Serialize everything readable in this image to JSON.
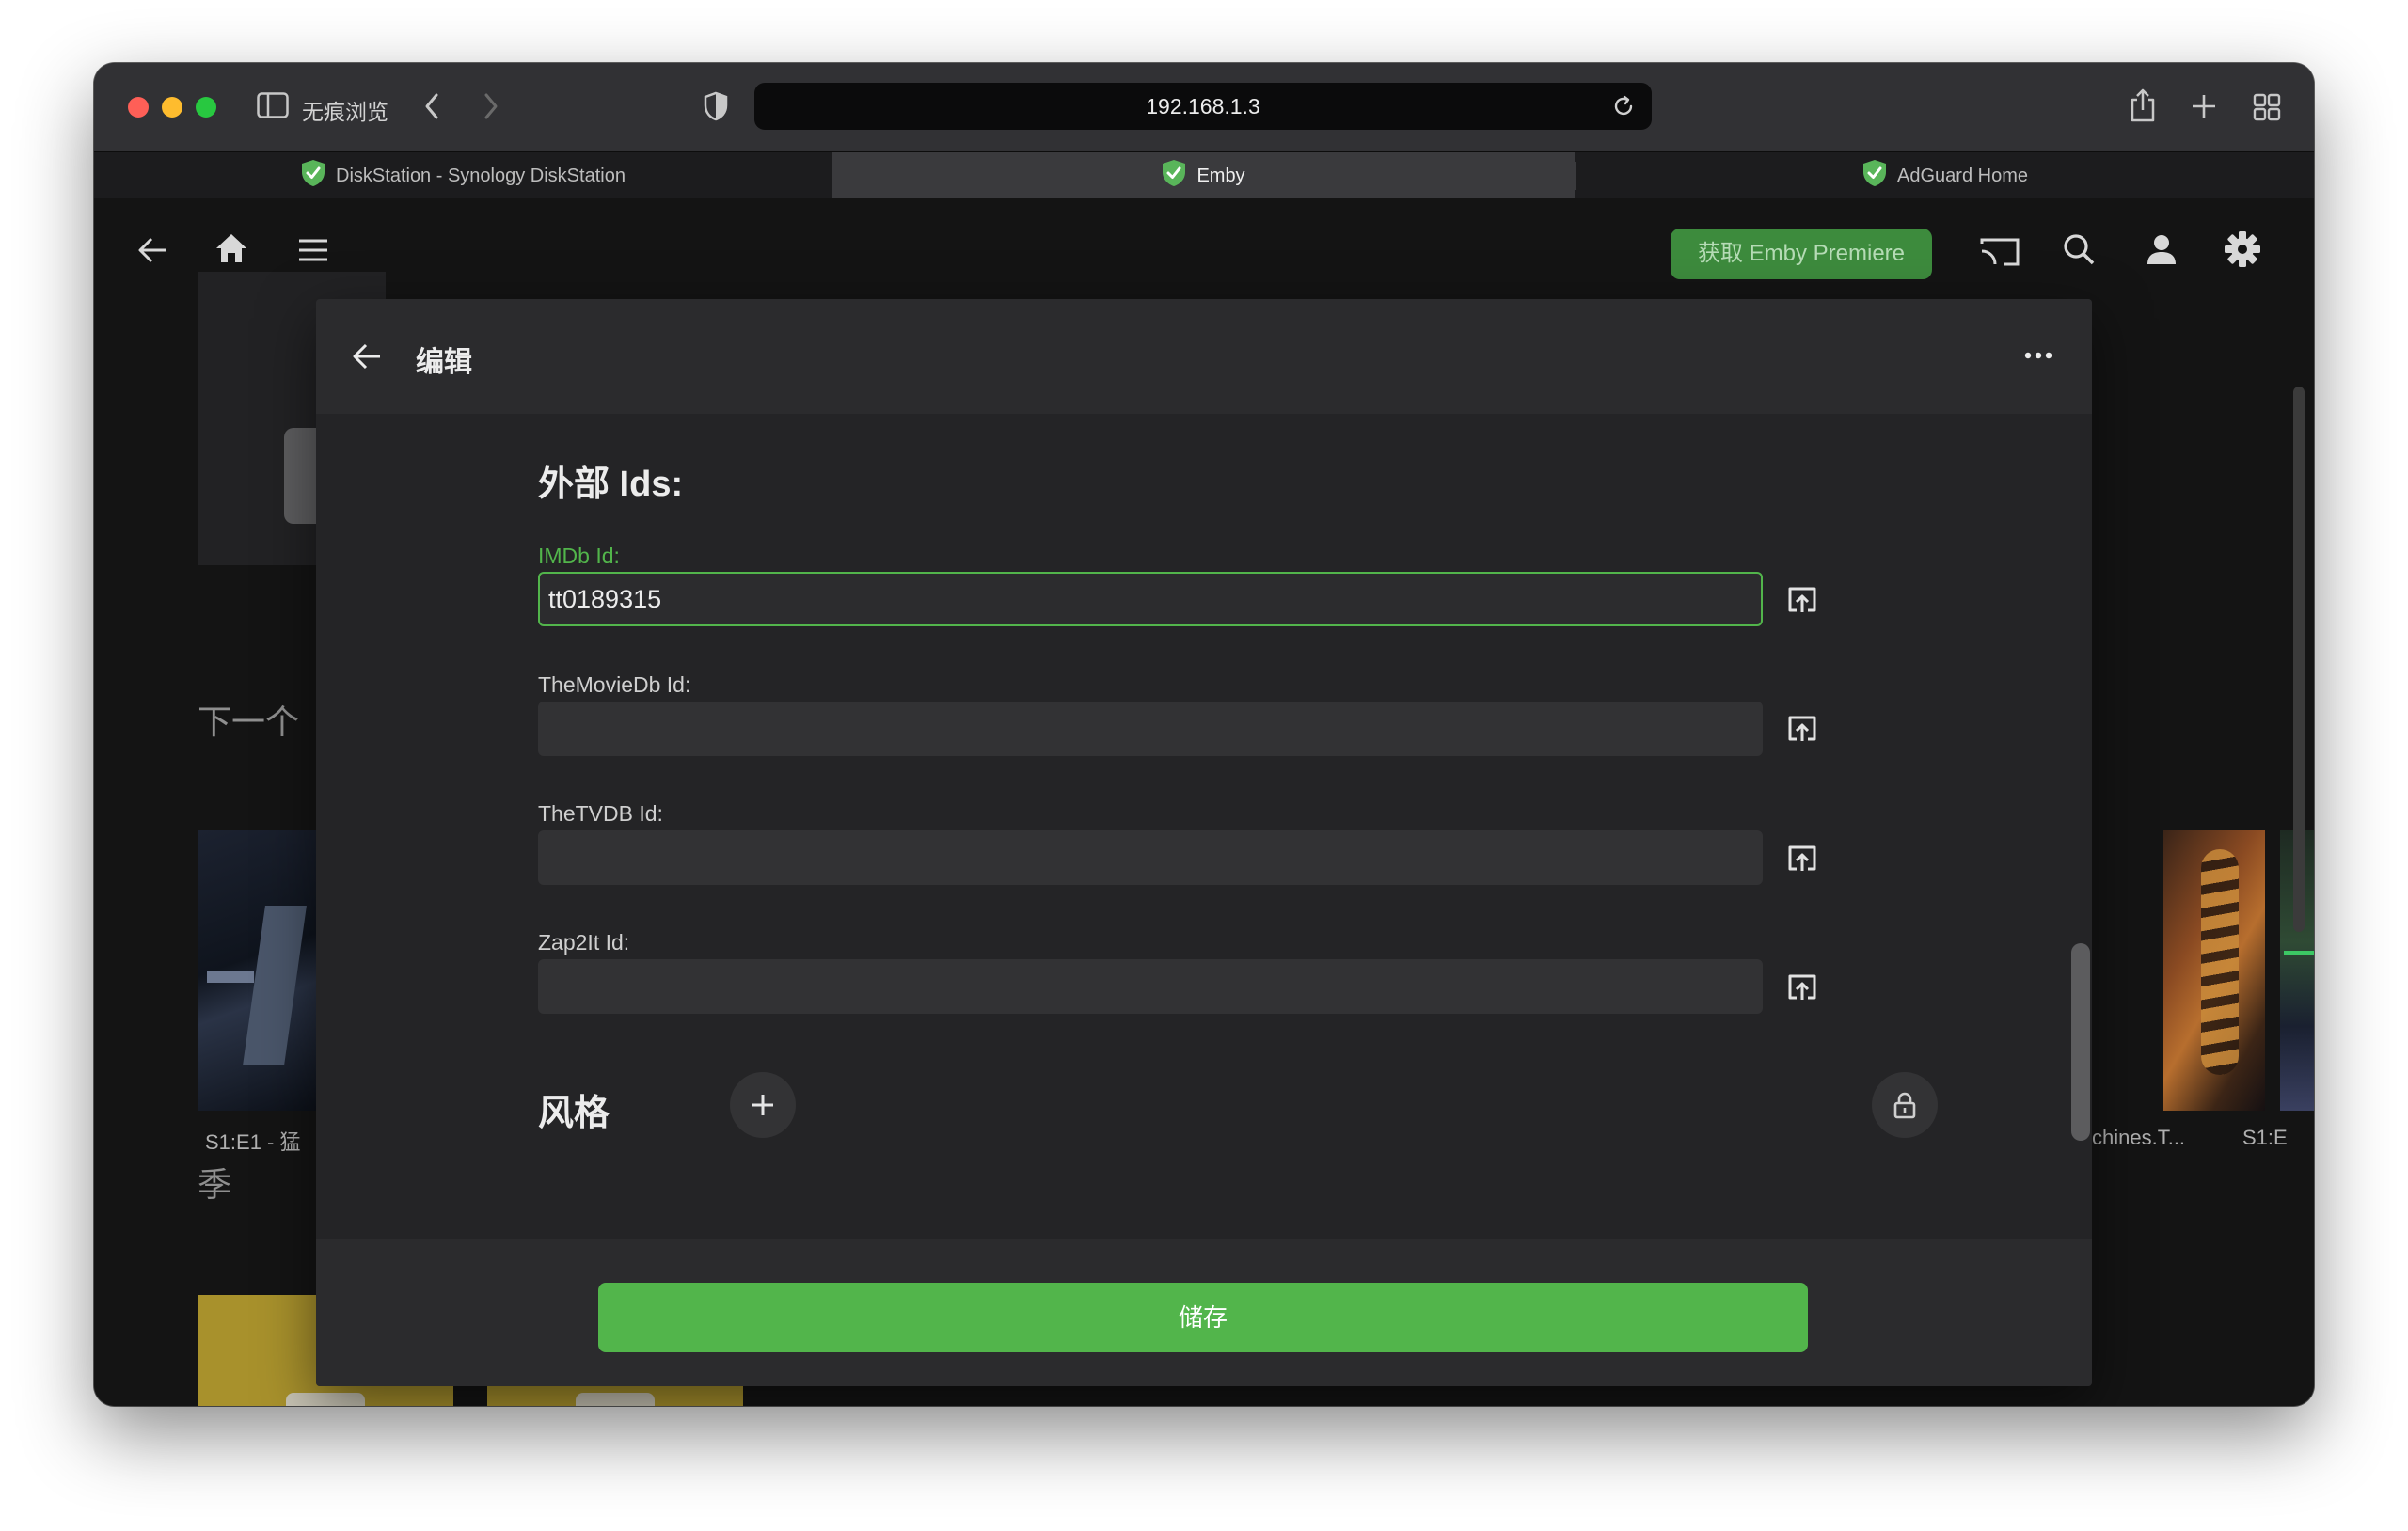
{
  "browser": {
    "private_label": "无痕浏览",
    "url": "192.168.1.3",
    "tabs": [
      {
        "label": "DiskStation - Synology DiskStation",
        "active": false
      },
      {
        "label": "Emby",
        "active": true
      },
      {
        "label": "AdGuard Home",
        "active": false
      }
    ]
  },
  "app": {
    "premiere_label": "获取 Emby Premiere",
    "sections": {
      "next_up": "下一个",
      "seasons": "季"
    },
    "captions": {
      "left": "S1:E1 - 猛",
      "right": "chines.T...",
      "far_right": "S1:E"
    }
  },
  "dialog": {
    "title": "编辑",
    "section_title": "外部 Ids:",
    "fields": [
      {
        "label": "IMDb Id:",
        "value": "tt0189315",
        "focused": true
      },
      {
        "label": "TheMovieDb Id:",
        "value": ""
      },
      {
        "label": "TheTVDB Id:",
        "value": ""
      },
      {
        "label": "Zap2It Id:",
        "value": ""
      }
    ],
    "genre_title": "风格",
    "save_label": "储存"
  },
  "colors": {
    "accent_green": "#52b54b",
    "premiere_green": "#3d8b3d",
    "background": "#141414",
    "dialog": "#242426"
  }
}
